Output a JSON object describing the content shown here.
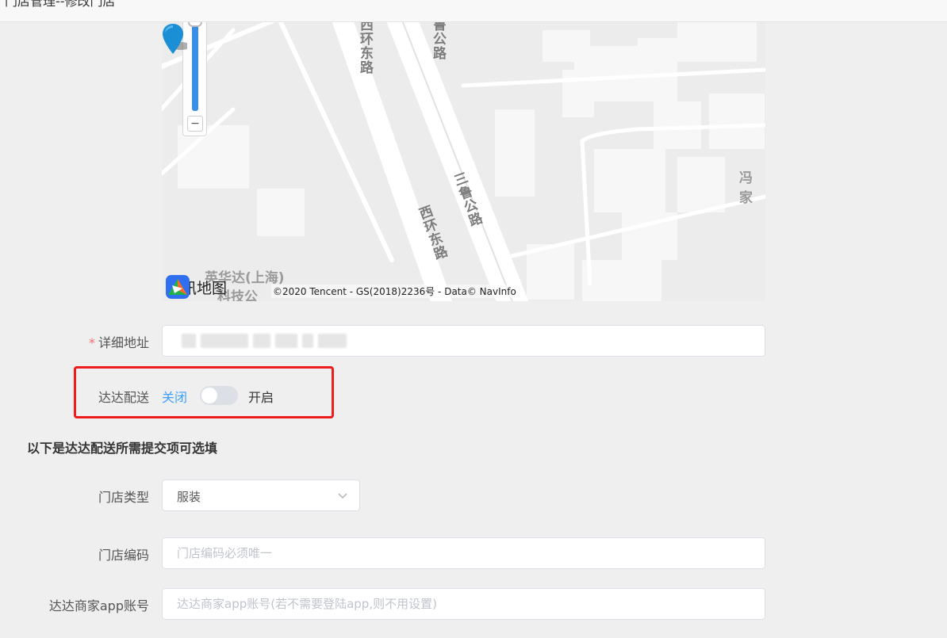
{
  "page": {
    "title": "门店管理--修改门店"
  },
  "map": {
    "road_labels": [
      "西环东路",
      "鲁公路",
      "三鲁公路",
      "西环东路"
    ],
    "place_labels": [
      "冯家",
      "英华达(上海)",
      "科技公"
    ],
    "brand": "腾讯地图",
    "copyright": "©2020 Tencent - GS(2018)2236号 - Data© NavInfo",
    "zoom_out_label": "−"
  },
  "form": {
    "address": {
      "label": "详细地址",
      "required_mark": "*"
    },
    "dada": {
      "label": "达达配送",
      "off_label": "关闭",
      "on_label": "开启",
      "enabled": false
    },
    "optional_section_title": "以下是达达配送所需提交项可选填",
    "store_type": {
      "label": "门店类型",
      "value": "服装"
    },
    "store_code": {
      "label": "门店编码",
      "placeholder": "门店编码必须唯一"
    },
    "dada_account": {
      "label": "达达商家app账号",
      "placeholder": "达达商家app账号(若不需要登陆app,则不用设置)"
    }
  },
  "colors": {
    "accent": "#409eff",
    "highlight_border": "#ee1c1c",
    "required": "#f56c6c",
    "pin": "#1a8fd6"
  }
}
